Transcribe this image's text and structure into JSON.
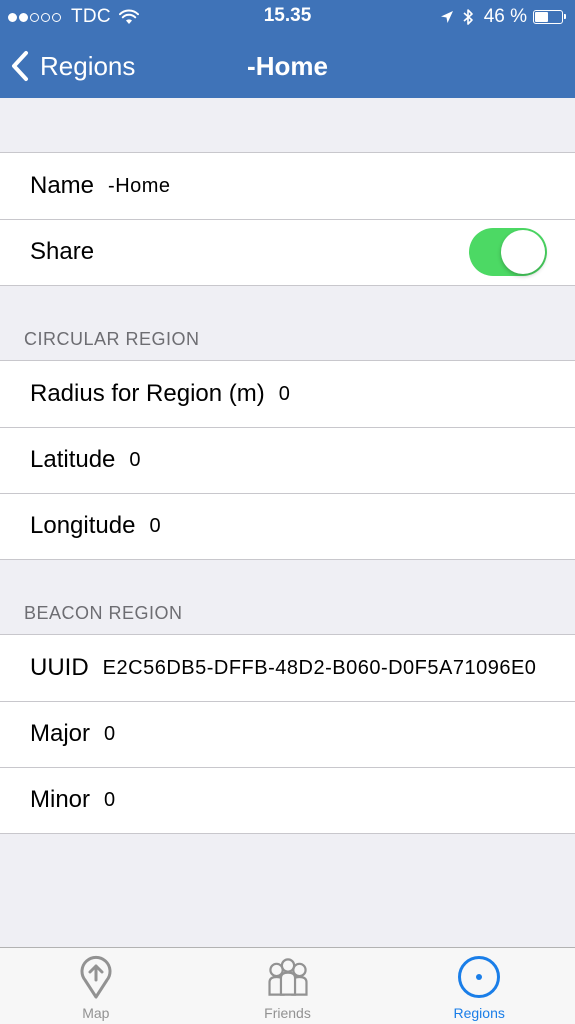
{
  "status_bar": {
    "carrier": "TDC",
    "time": "15.35",
    "battery": "46 %",
    "battery_level": 0.46
  },
  "nav": {
    "back_label": "Regions",
    "title": "-Home"
  },
  "general": {
    "name_label": "Name",
    "name_value": "-Home",
    "share_label": "Share",
    "share_on": true
  },
  "circular": {
    "header": "CIRCULAR REGION",
    "radius_label": "Radius for Region (m)",
    "radius_value": "0",
    "latitude_label": "Latitude",
    "latitude_value": "0",
    "longitude_label": "Longitude",
    "longitude_value": "0"
  },
  "beacon": {
    "header": "BEACON REGION",
    "uuid_label": "UUID",
    "uuid_value": "E2C56DB5-DFFB-48D2-B060-D0F5A71096E0",
    "major_label": "Major",
    "major_value": "0",
    "minor_label": "Minor",
    "minor_value": "0"
  },
  "tabs": [
    {
      "label": "Map",
      "icon": "map-pin-icon",
      "active": false
    },
    {
      "label": "Friends",
      "icon": "friends-icon",
      "active": false
    },
    {
      "label": "Regions",
      "icon": "region-target-icon",
      "active": true
    }
  ],
  "colors": {
    "nav_background": "#3f73b8",
    "toggle_on": "#4cd964",
    "tab_active": "#1a7ee8",
    "tab_inactive": "#929292"
  }
}
